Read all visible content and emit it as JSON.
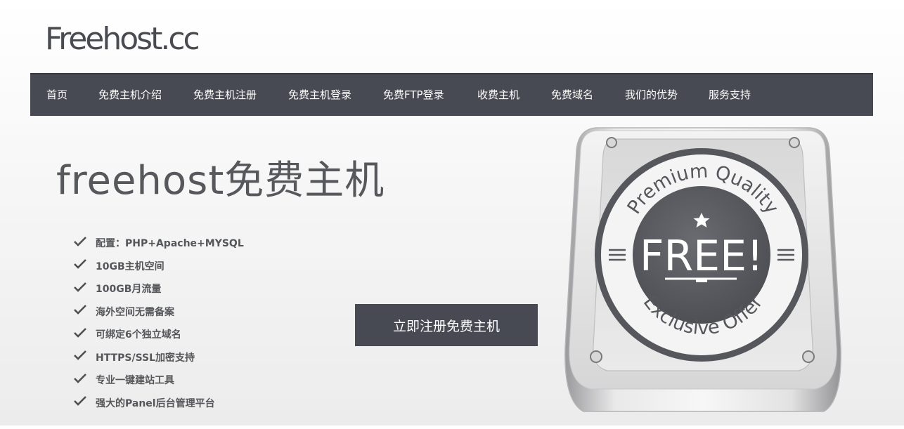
{
  "header": {
    "logo_text": "Freehost.cc"
  },
  "nav": {
    "items": [
      {
        "label": "首页"
      },
      {
        "label": "免费主机介绍"
      },
      {
        "label": "免费主机注册"
      },
      {
        "label": "免费主机登录"
      },
      {
        "label": "免费FTP登录"
      },
      {
        "label": "收费主机"
      },
      {
        "label": "免费域名"
      },
      {
        "label": "我们的优势"
      },
      {
        "label": "服务支持"
      }
    ]
  },
  "hero": {
    "title": "freehost免费主机",
    "features": [
      "配置：PHP+Apache+MYSQL",
      "10GB主机空间",
      "100GB月流量",
      "海外空间无需备案",
      "可绑定6个独立域名",
      "HTTPS/SSL加密支持",
      "专业一键建站工具",
      "强大的Panel后台管理平台"
    ],
    "cta_label": "立即注册免费主机"
  },
  "badge": {
    "top_text": "Premium Quality",
    "center_text": "FREE!",
    "bottom_text": "Exclusive Offer"
  },
  "colors": {
    "nav_bg": "#474a52",
    "text_gray": "#555659",
    "cta_bg": "#474a52"
  }
}
